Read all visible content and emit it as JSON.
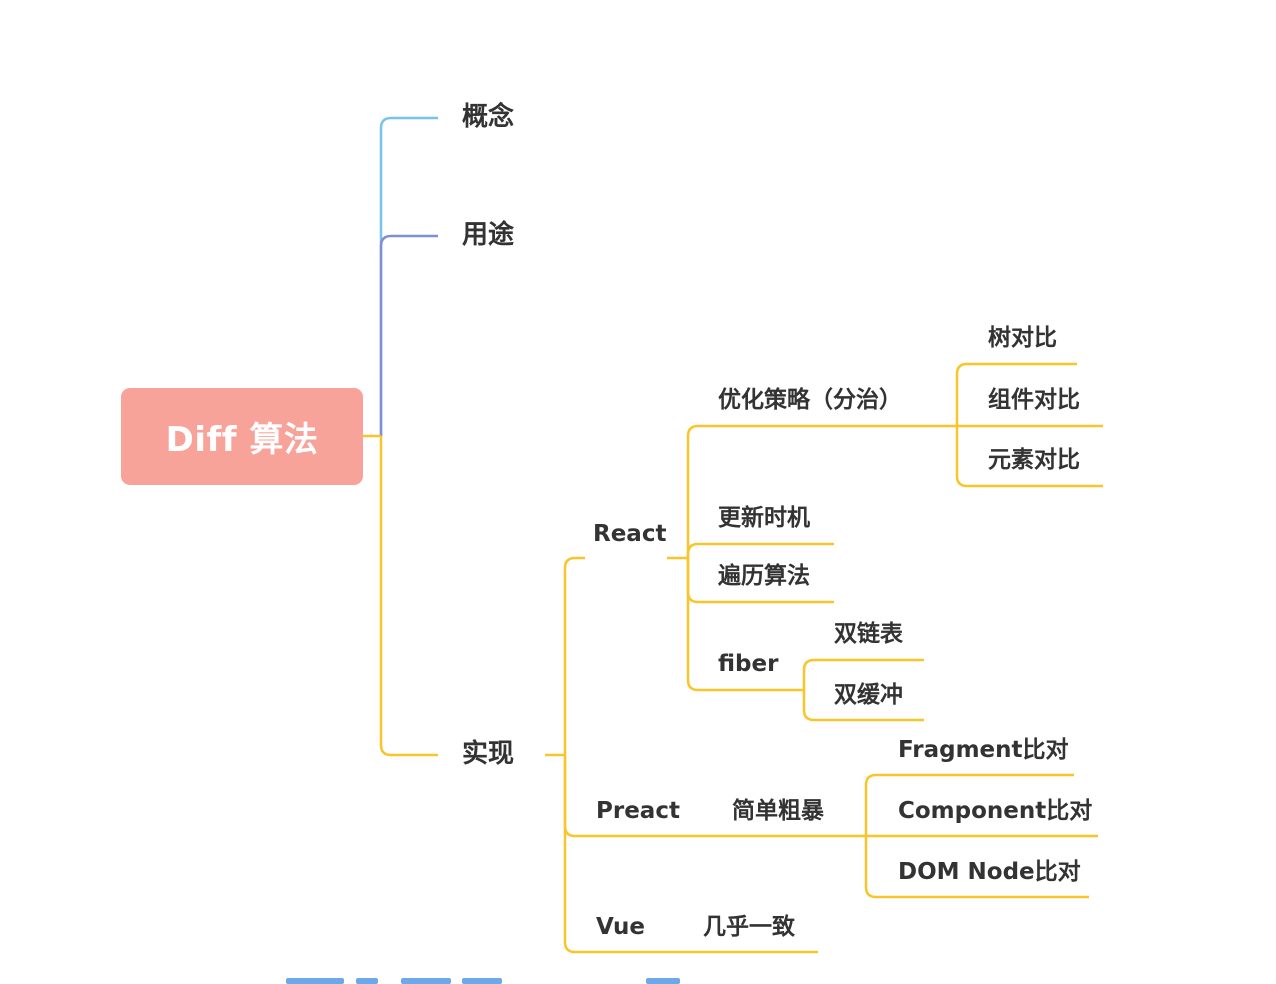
{
  "root": {
    "label": "Diff 算法",
    "color": "#f8a39a"
  },
  "level1": {
    "concept": "概念",
    "usage": "用途",
    "implementation": "实现"
  },
  "implementation": {
    "react": {
      "label": "React",
      "strategy": {
        "label": "优化策略（分治）",
        "items": [
          "树对比",
          "组件对比",
          "元素对比"
        ]
      },
      "update_timing": "更新时机",
      "traversal": "遍历算法",
      "fiber": {
        "label": "fiber",
        "items": [
          "双链表",
          "双缓冲"
        ]
      }
    },
    "preact": {
      "label": "Preact",
      "approach": "简单粗暴",
      "items": [
        "Fragment比对",
        "Component比对",
        "DOM Node比对"
      ]
    },
    "vue": {
      "label": "Vue",
      "note": "几乎一致"
    }
  },
  "colors": {
    "concept_line": "#74c4ec",
    "usage_line": "#7f8fd6",
    "implementation_line": "#f8c62a",
    "text": "#333333"
  }
}
